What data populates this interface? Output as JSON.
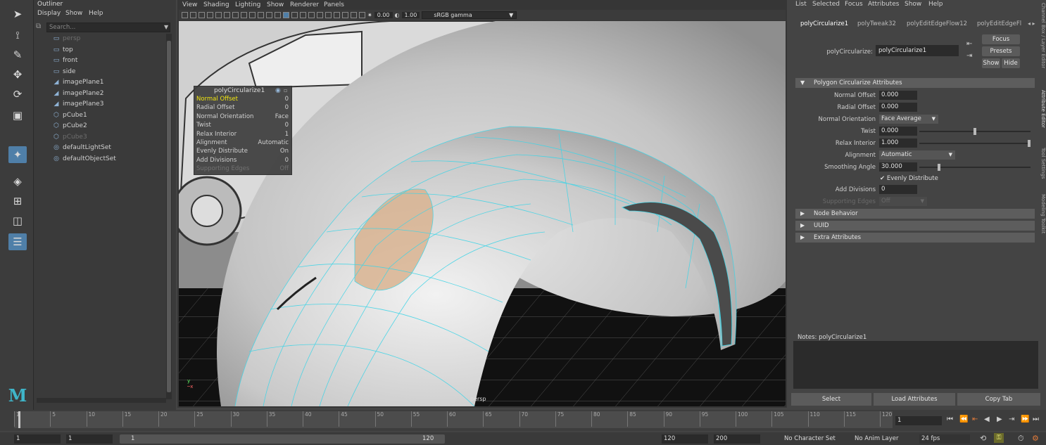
{
  "outliner": {
    "title": "Outliner",
    "menu": [
      "Display",
      "Show",
      "Help"
    ],
    "search_placeholder": "Search...",
    "items": [
      {
        "label": "persp",
        "icon": "camera-icon",
        "dim": true
      },
      {
        "label": "top",
        "icon": "camera-icon",
        "dim": false
      },
      {
        "label": "front",
        "icon": "camera-icon",
        "dim": false
      },
      {
        "label": "side",
        "icon": "camera-icon",
        "dim": false
      },
      {
        "label": "imagePlane1",
        "icon": "image-plane-icon",
        "dim": false
      },
      {
        "label": "imagePlane2",
        "icon": "image-plane-icon",
        "dim": false
      },
      {
        "label": "imagePlane3",
        "icon": "image-plane-icon",
        "dim": false
      },
      {
        "label": "pCube1",
        "icon": "mesh-icon",
        "dim": false
      },
      {
        "label": "pCube2",
        "icon": "mesh-icon",
        "dim": false
      },
      {
        "label": "pCube3",
        "icon": "mesh-icon",
        "dim": true
      },
      {
        "label": "defaultLightSet",
        "icon": "set-icon",
        "dim": false
      },
      {
        "label": "defaultObjectSet",
        "icon": "set-icon",
        "dim": false
      }
    ]
  },
  "viewport": {
    "menu": [
      "View",
      "Shading",
      "Lighting",
      "Show",
      "Renderer",
      "Panels"
    ],
    "exposure": "0.00",
    "gamma_value": "1.00",
    "color_space": "sRGB gamma",
    "camera_label": "persp"
  },
  "popup": {
    "title": "polyCircularize1",
    "rows": [
      {
        "label": "Normal Offset",
        "value": "0",
        "hl": true
      },
      {
        "label": "Radial Offset",
        "value": "0"
      },
      {
        "label": "Normal Orientation",
        "value": "Face"
      },
      {
        "label": "Twist",
        "value": "0"
      },
      {
        "label": "Relax Interior",
        "value": "1"
      },
      {
        "label": "Alignment",
        "value": "Automatic"
      },
      {
        "label": "Evenly Distribute",
        "value": "On"
      },
      {
        "label": "Add Divisions",
        "value": "0"
      },
      {
        "label": "Supporting Edges",
        "value": "Off",
        "dim": true
      }
    ]
  },
  "attr": {
    "menu": [
      "List",
      "Selected",
      "Focus",
      "Attributes",
      "Show",
      "Help"
    ],
    "tabs": [
      "polyCircularize1",
      "polyTweak32",
      "polyEditEdgeFlow12",
      "polyEditEdgeFl"
    ],
    "node_label": "polyCircularize:",
    "node_value": "polyCircularize1",
    "focus": "Focus",
    "presets": "Presets",
    "show": "Show",
    "hide": "Hide",
    "section_title": "Polygon Circularize Attributes",
    "normal_offset_label": "Normal Offset",
    "normal_offset": "0.000",
    "radial_offset_label": "Radial Offset",
    "radial_offset": "0.000",
    "normal_orientation_label": "Normal Orientation",
    "normal_orientation": "Face Average",
    "twist_label": "Twist",
    "twist": "0.000",
    "twist_level": 0.5,
    "relax_label": "Relax Interior",
    "relax": "1.000",
    "relax_level": 1.0,
    "alignment_label": "Alignment",
    "alignment": "Automatic",
    "smoothing_label": "Smoothing Angle",
    "smoothing": "30.000",
    "smoothing_level": 0.17,
    "evenly_label": "Evenly Distribute",
    "add_div_label": "Add Divisions",
    "add_div": "0",
    "supporting_label": "Supporting Edges",
    "supporting": "Off",
    "node_behavior": "Node Behavior",
    "uuid": "UUID",
    "extra": "Extra Attributes",
    "notes_label": "Notes:  polyCircularize1",
    "select": "Select",
    "load": "Load Attributes",
    "copy": "Copy Tab",
    "side_tabs": [
      "Channel Box / Layer Editor",
      "Attribute Editor",
      "Tool Settings",
      "Modeling Toolkit"
    ]
  },
  "timeline": {
    "ticks": [
      "1",
      "5",
      "10",
      "15",
      "20",
      "25",
      "30",
      "35",
      "40",
      "45",
      "50",
      "55",
      "60",
      "65",
      "70",
      "75",
      "80",
      "85",
      "90",
      "95",
      "100",
      "105",
      "110",
      "115",
      "120"
    ],
    "current_frame": "1"
  },
  "range": {
    "start": "1",
    "playback_start": "1",
    "slider_start": "1",
    "slider_end": "120",
    "playback_end": "120",
    "end": "200",
    "char_set": "No Character Set",
    "anim_layer": "No Anim Layer",
    "fps": "24 fps"
  },
  "colors": {
    "accent": "#4f7fa8",
    "wire": "#3fd4e6",
    "highlight": "#f2e600"
  }
}
